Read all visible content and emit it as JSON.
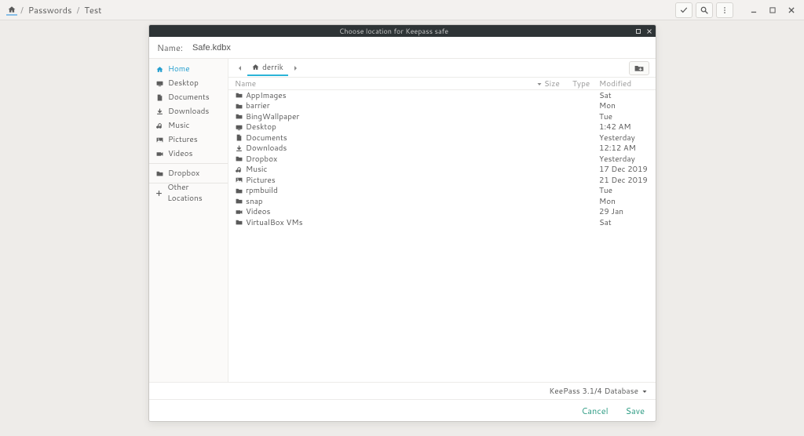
{
  "header": {
    "breadcrumb": [
      "Passwords",
      "Test"
    ]
  },
  "dialog": {
    "title": "Choose location for Keepass safe",
    "name_label": "Name:",
    "file_name": "Safe.kdbx",
    "format_label": "KeePass 3.1/4 Database",
    "cancel": "Cancel",
    "save": "Save"
  },
  "sidebar": {
    "groups": [
      [
        {
          "icon": "home",
          "label": "Home",
          "active": true
        },
        {
          "icon": "desktop",
          "label": "Desktop"
        },
        {
          "icon": "document",
          "label": "Documents"
        },
        {
          "icon": "download",
          "label": "Downloads"
        },
        {
          "icon": "music",
          "label": "Music"
        },
        {
          "icon": "pictures",
          "label": "Pictures"
        },
        {
          "icon": "videos",
          "label": "Videos"
        }
      ],
      [
        {
          "icon": "folder",
          "label": "Dropbox"
        }
      ],
      [
        {
          "icon": "plus",
          "label": "Other Locations"
        }
      ]
    ]
  },
  "pathbar": {
    "current": "derrik"
  },
  "columns": {
    "name": "Name",
    "size": "Size",
    "type": "Type",
    "modified": "Modified"
  },
  "files": [
    {
      "icon": "folder",
      "name": "AppImages",
      "modified": "Sat"
    },
    {
      "icon": "folder",
      "name": "barrier",
      "modified": "Mon"
    },
    {
      "icon": "folder",
      "name": "BingWallpaper",
      "modified": "Tue"
    },
    {
      "icon": "desktop",
      "name": "Desktop",
      "modified": "1:42 AM"
    },
    {
      "icon": "document",
      "name": "Documents",
      "modified": "Yesterday"
    },
    {
      "icon": "download",
      "name": "Downloads",
      "modified": "12:12 AM"
    },
    {
      "icon": "folder",
      "name": "Dropbox",
      "modified": "Yesterday"
    },
    {
      "icon": "music",
      "name": "Music",
      "modified": "17 Dec 2019"
    },
    {
      "icon": "pictures",
      "name": "Pictures",
      "modified": "21 Dec 2019"
    },
    {
      "icon": "folder",
      "name": "rpmbuild",
      "modified": "Tue"
    },
    {
      "icon": "folder",
      "name": "snap",
      "modified": "Mon"
    },
    {
      "icon": "videos",
      "name": "Videos",
      "modified": "29 Jan"
    },
    {
      "icon": "folder",
      "name": "VirtualBox VMs",
      "modified": "Sat"
    }
  ]
}
